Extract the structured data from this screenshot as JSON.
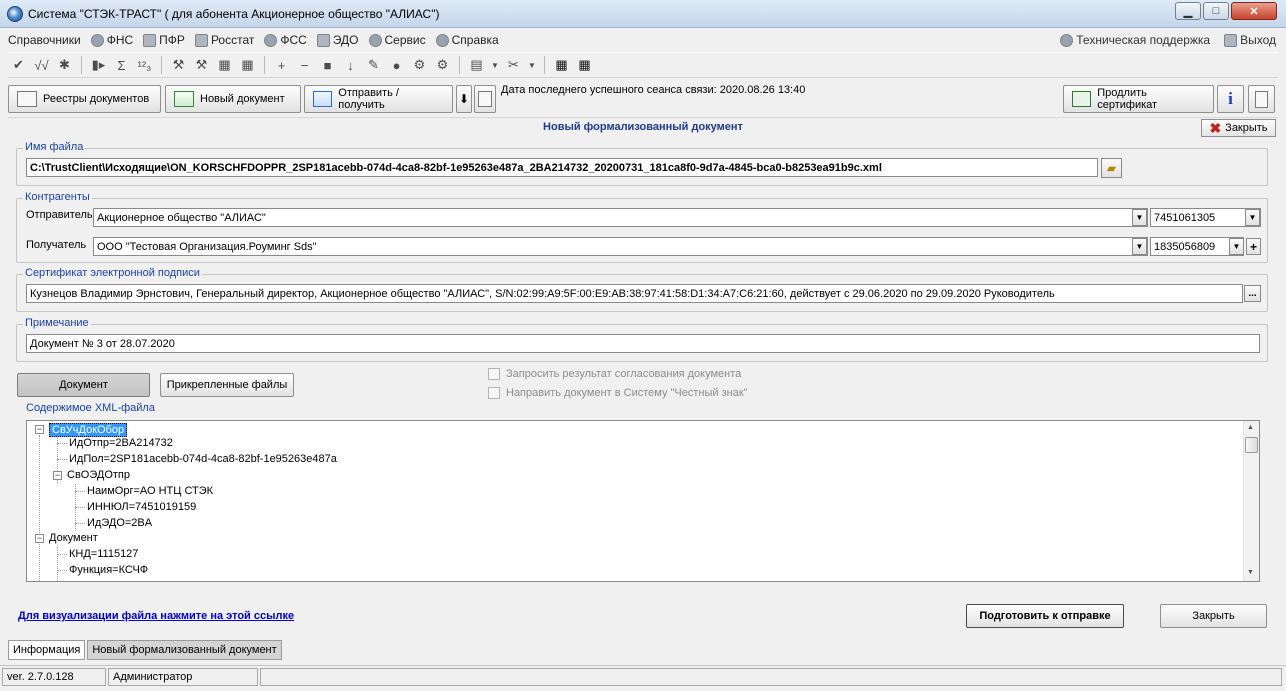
{
  "window": {
    "title": "Система \"СТЭК-ТРАСТ\" ( для абонента Акционерное общество \"АЛИАС\")",
    "controls": {
      "minimize": "▁",
      "maximize": "□",
      "close": "✕"
    }
  },
  "menu": {
    "items": [
      {
        "label": "Справочники"
      },
      {
        "label": "ФНС",
        "icon": "gear-icon"
      },
      {
        "label": "ПФР",
        "icon": "pfr-icon"
      },
      {
        "label": "Росстат",
        "icon": "factory-icon"
      },
      {
        "label": "ФСС",
        "icon": "fss-icon"
      },
      {
        "label": "ЭДО",
        "icon": "edo-icon"
      },
      {
        "label": "Сервис",
        "icon": "gear-icon"
      },
      {
        "label": "Справка",
        "icon": "help-icon"
      }
    ],
    "support": "Техническая поддержка",
    "exit": "Выход"
  },
  "toolbar1": {
    "icons": [
      "✔",
      "√√",
      "✱",
      "▮▸",
      "Σ",
      "¹²₃",
      "⚒",
      "⚒",
      "▦",
      "▦",
      "+",
      "−",
      "■",
      "↓",
      "✎",
      "●",
      "⚙",
      "⚙",
      "▤",
      "✂",
      "▦",
      "▦"
    ]
  },
  "toolbar2": {
    "registry": "Реестры документов",
    "new_doc": "Новый документ",
    "send_receive": "Отправить / получить",
    "last_session": "Дата последнего успешного сеанса связи: 2020.08.26 13:40",
    "renew_cert": "Продлить сертификат",
    "info_icon": "i"
  },
  "doc": {
    "title": "Новый формализованный документ",
    "close_label": "Закрыть",
    "file": {
      "legend": "Имя файла",
      "value": "C:\\TrustClient\\Исходящие\\ON_KORSCHFDOPPR_2SP181acebb-074d-4ca8-82bf-1e95263e487a_2BA214732_20200731_181ca8f0-9d7a-4845-bca0-b8253ea91b9c.xml"
    },
    "contractors": {
      "legend": "Контрагенты",
      "sender_label": "Отправитель",
      "sender_value": "Акционерное общество \"АЛИАС\"",
      "sender_inn": "7451061305",
      "receiver_label": "Получатель",
      "receiver_value": "ООО \"Тестовая Организация.Роуминг Sds\"",
      "receiver_inn": "1835056809"
    },
    "certificate": {
      "legend": "Сертификат электронной подписи",
      "value": "Кузнецов Владимир Эрнстович, Генеральный директор, Акционерное общество \"АЛИАС\", S/N:02:99:A9:5F:00:E9:AB:38:97:41:58:D1:34:A7:C6:21:60, действует с 29.06.2020 по 29.09.2020 Руководитель",
      "browse": "..."
    },
    "note": {
      "legend": "Примечание",
      "value": "Документ № 3 от 28.07.2020"
    },
    "btn_document": "Документ",
    "btn_attached": "Прикрепленные файлы",
    "chk_request": "Запросить результат согласования документа",
    "chk_honest": "Направить документ в Систему \"Честный знак\"",
    "xml": {
      "legend": "Содержимое XML-файла",
      "nodes": [
        {
          "text": "СвУчДокОбор",
          "toggle": "−"
        },
        {
          "text": "ИдОтпр=2BA214732"
        },
        {
          "text": "ИдПол=2SP181acebb-074d-4ca8-82bf-1e95263e487a"
        },
        {
          "text": "СвОЭДОтпр",
          "toggle": "−"
        },
        {
          "text": "НаимОрг=АО НТЦ СТЭК"
        },
        {
          "text": "ИННЮЛ=7451019159"
        },
        {
          "text": "ИдЭДО=2BA"
        },
        {
          "text": "Документ",
          "toggle": "−"
        },
        {
          "text": "КНД=1115127"
        },
        {
          "text": "Функция=КСЧФ"
        }
      ]
    },
    "visualize_link": "Для визуализации файла нажмите на этой ссылке",
    "prepare": "Подготовить к отправке",
    "close_bottom": "Закрыть"
  },
  "tabs": [
    {
      "label": "Информация"
    },
    {
      "label": "Новый формализованный документ"
    }
  ],
  "status": {
    "version": "ver. 2.7.0.128",
    "user": "Администратор"
  },
  "colors": {
    "accent": "#1a3fa8",
    "selection": "#3399ff",
    "link": "#0000cc"
  }
}
